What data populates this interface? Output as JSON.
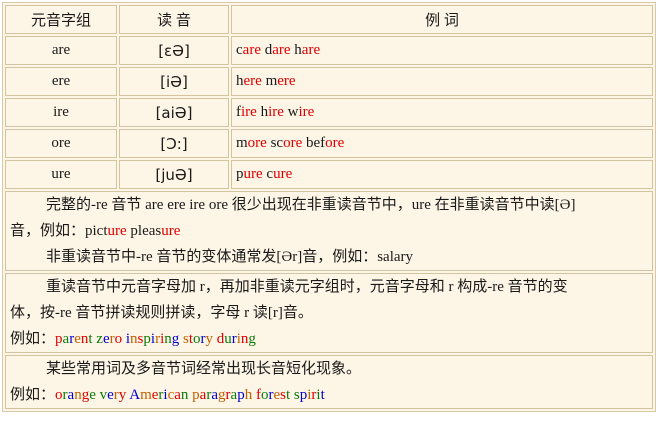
{
  "headers": {
    "col1": "元音字组",
    "col2": "读 音",
    "col3": "例 词"
  },
  "rows": [
    {
      "vowel": "are",
      "ipa": "[εƏ]",
      "words": [
        [
          "c",
          "are",
          " d",
          "are",
          " h",
          "are"
        ]
      ]
    },
    {
      "vowel": "ere",
      "ipa": "[iƏ]",
      "words": [
        [
          "h",
          "ere",
          " m",
          "ere"
        ]
      ]
    },
    {
      "vowel": "ire",
      "ipa": "[aiƏ]",
      "words": [
        [
          "f",
          "ire",
          " h",
          "ire",
          " w",
          "ire"
        ]
      ]
    },
    {
      "vowel": "ore",
      "ipa": "[Ɔ:]",
      "words": [
        [
          "m",
          "ore",
          " sc",
          "ore",
          " bef",
          "ore"
        ]
      ]
    },
    {
      "vowel": "ure",
      "ipa": "[juƏ]",
      "words": [
        [
          "p",
          "ure",
          " c",
          "ure"
        ]
      ]
    }
  ],
  "note1": {
    "line1": "完整的-re 音节 are ere ire ore 很少出现在非重读音节中，ure 在非重读音节中读[Ə]",
    "line2_prefix": "音，例如：",
    "line2_word_a": "pict",
    "line2_word_b": "ure",
    "line2_word_c": " pleas",
    "line2_word_d": "ure",
    "line3": "非重读音节中-re 音节的变体通常发[Ər]音，例如：salary"
  },
  "note2": {
    "line1": "重读音节中元音字母加 r，再加非重读元字组时，元音字母和 r 构成-re 音节的变",
    "line2": "体，按-re 音节拼读规则拼读，字母 r 读[r]音。",
    "example_prefix": "例如：",
    "example_words": [
      "parent",
      "zero",
      "inspiring",
      "story",
      "during"
    ]
  },
  "note3": {
    "line1": "某些常用词及多音节词经常出现长音短化现象。",
    "example_prefix": "例如：",
    "example_words": [
      "orange",
      "very",
      "American",
      "paragraph",
      "forest",
      "spirit"
    ]
  },
  "colors": {
    "highlight": "#e00000",
    "text": "#1a1a1a",
    "cell_bg": "#fdf5e6",
    "border": "#d3c39f"
  }
}
